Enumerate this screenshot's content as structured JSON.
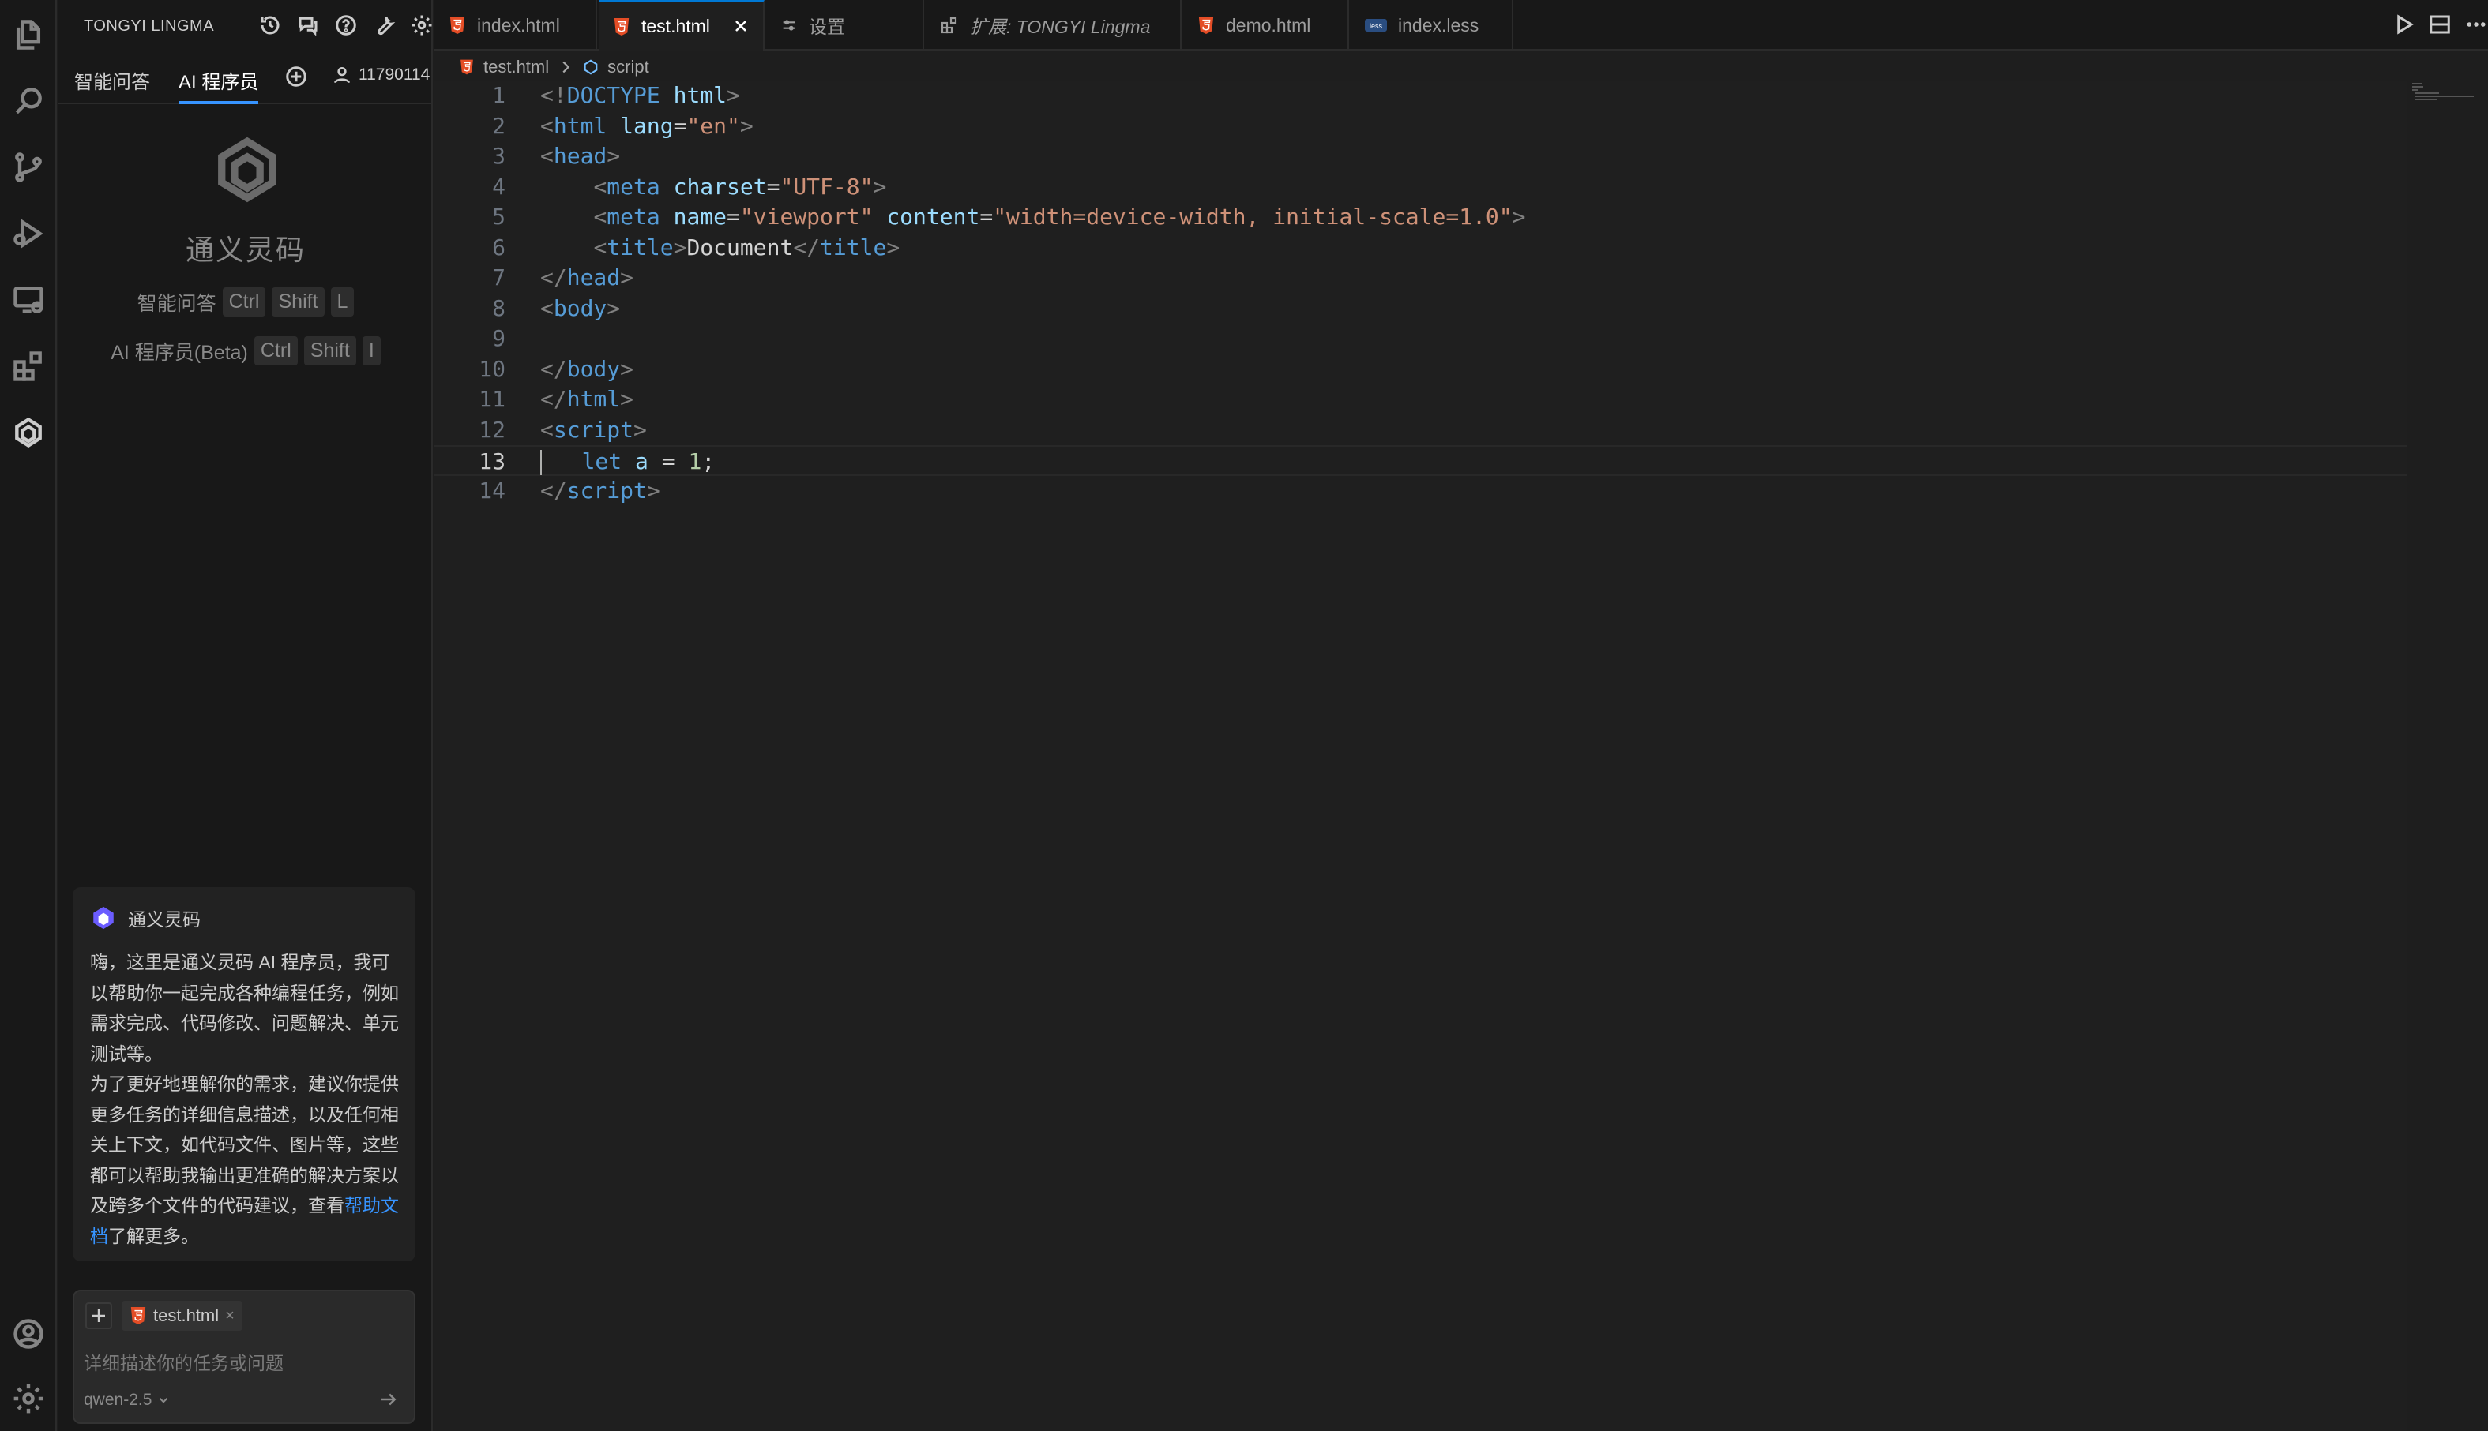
{
  "sidebar": {
    "title": "TONGYI LINGMA",
    "header_icons": [
      "history-icon",
      "chat-bubbles-icon",
      "help-icon",
      "wrench-icon",
      "gear-icon"
    ],
    "tabs": [
      {
        "label": "智能问答",
        "active": false
      },
      {
        "label": "AI 程序员",
        "active": true
      }
    ],
    "user_id": "11790114",
    "brand_name": "通义灵码",
    "shortcuts": [
      {
        "label": "智能问答",
        "keys": [
          "Ctrl",
          "Shift",
          "L"
        ]
      },
      {
        "label": "AI 程序员(Beta)",
        "keys": [
          "Ctrl",
          "Shift",
          "I"
        ]
      }
    ],
    "welcome": {
      "sender": "通义灵码",
      "paragraph1": "嗨，这里是通义灵码 AI 程序员，我可以帮助你一起完成各种编程任务，例如需求完成、代码修改、问题解决、单元测试等。",
      "paragraph2_before": "为了更好地理解你的需求，建议你提供更多任务的详细信息描述，以及任何相关上下文，如代码文件、图片等，这些都可以帮助我输出更准确的解决方案以及跨多个文件的代码建议，查看",
      "link": "帮助文档",
      "paragraph2_after": "了解更多。"
    },
    "chat_input": {
      "context_file": "test.html",
      "placeholder": "详细描述你的任务或问题",
      "model": "qwen-2.5"
    }
  },
  "tabs": [
    {
      "label": "index.html",
      "icon": "html5-icon",
      "active": false
    },
    {
      "label": "test.html",
      "icon": "html5-icon",
      "active": true
    },
    {
      "label": "设置",
      "icon": "settings-sliders-icon",
      "active": false
    },
    {
      "label": "扩展: TONGYI Lingma",
      "icon": "extension-icon",
      "active": false
    },
    {
      "label": "demo.html",
      "icon": "html5-icon",
      "active": false
    },
    {
      "label": "index.less",
      "icon": "less-icon",
      "active": false
    }
  ],
  "breadcrumb": {
    "file": "test.html",
    "symbol": "script"
  },
  "editor": {
    "current_line": 13,
    "line_numbers": [
      "1",
      "2",
      "3",
      "4",
      "5",
      "6",
      "7",
      "8",
      "9",
      "10",
      "11",
      "12",
      "13",
      "14"
    ]
  },
  "colors": {
    "accent": "#0078d4",
    "link": "#3794ff",
    "html5": "#e44d26",
    "brand_purple": "#6b5cff"
  }
}
